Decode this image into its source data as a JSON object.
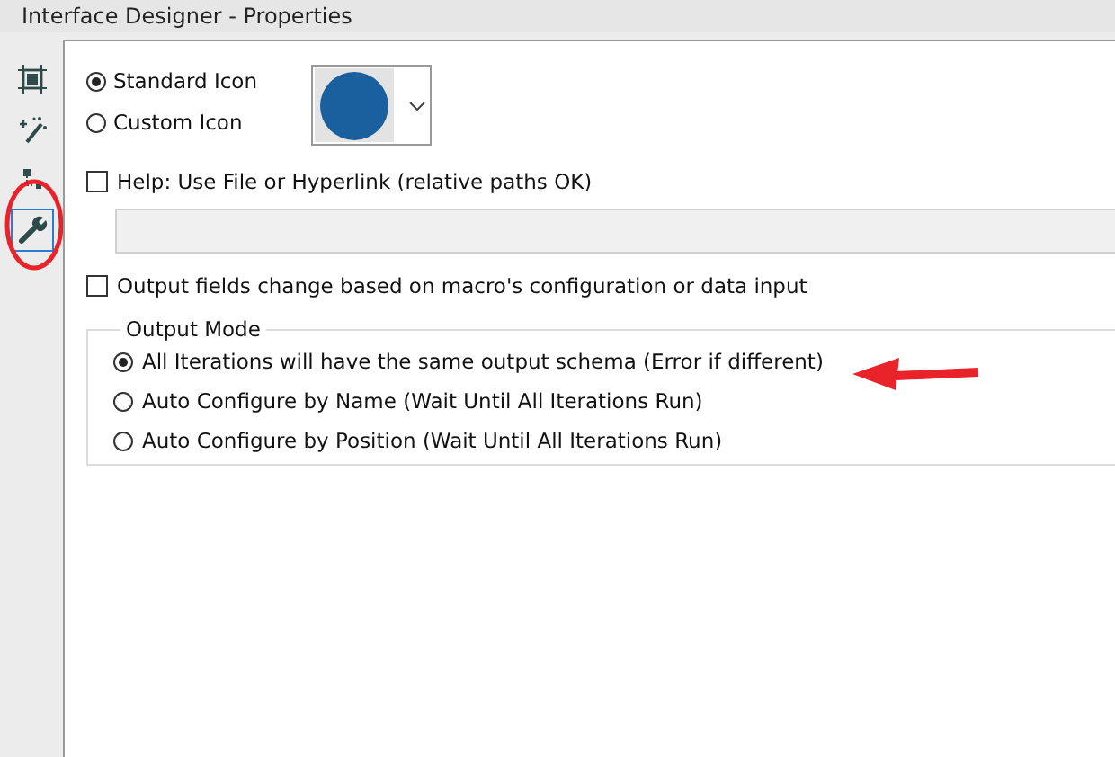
{
  "window": {
    "title": "Interface Designer - Properties"
  },
  "toolbar": [
    {
      "selected": false
    },
    {
      "selected": false
    },
    {
      "selected": false
    },
    {
      "selected": true
    }
  ],
  "icon_choice": [
    {
      "label": "Standard Icon",
      "selected": true
    },
    {
      "label": "Custom Icon",
      "selected": false
    }
  ],
  "help": {
    "label": "Help: Use File or Hyperlink (relative paths OK)",
    "checked": false
  },
  "output_fields": {
    "label": "Output fields change based on macro's configuration or data input",
    "checked": false
  },
  "output_mode": {
    "title": "Output Mode",
    "options": [
      {
        "label": "All Iterations will have the same output schema (Error if different)",
        "selected": true
      },
      {
        "label": "Auto Configure by Name (Wait Until All Iterations Run)",
        "selected": false
      },
      {
        "label": "Auto Configure by Position (Wait Until All Iterations Run)",
        "selected": false
      }
    ]
  }
}
